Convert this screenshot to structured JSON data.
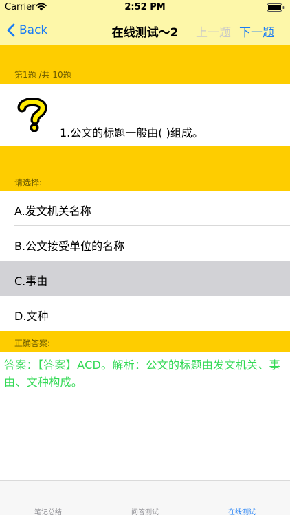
{
  "status_bar": {
    "carrier": "Carrier",
    "time": "2:52 PM"
  },
  "nav": {
    "back_label": "Back",
    "title": "在线测试～2",
    "prev_label": "上一题",
    "next_label": "下一题"
  },
  "progress_label": "第1题 /共 10题",
  "question": {
    "text": "1.公文的标题一般由( )组成。"
  },
  "choose_label": "请选择:",
  "options": [
    {
      "label": "A.发文机关名称",
      "selected": false
    },
    {
      "label": "B.公文接受单位的名称",
      "selected": false
    },
    {
      "label": "C.事由",
      "selected": true
    },
    {
      "label": "D.文种",
      "selected": false
    }
  ],
  "correct_answer_label": "正确答案:",
  "answer_text": "答案：【答案】ACD。解析：公文的标题由发文机关、事由、文种构成。",
  "tabs": [
    {
      "label": "笔记总结",
      "active": false
    },
    {
      "label": "问答测试",
      "active": false
    },
    {
      "label": "在线测试",
      "active": true
    }
  ],
  "colors": {
    "header_bg": "#fdf7a9",
    "band_bg": "#fecd00",
    "accent": "#1a7cf5",
    "answer_text": "#33d955",
    "selected_option_bg": "#d2d2d6"
  },
  "icons": {
    "back": "chevron-left-icon",
    "question": "question-mark-icon",
    "wifi": "wifi-icon",
    "battery": "battery-icon"
  }
}
